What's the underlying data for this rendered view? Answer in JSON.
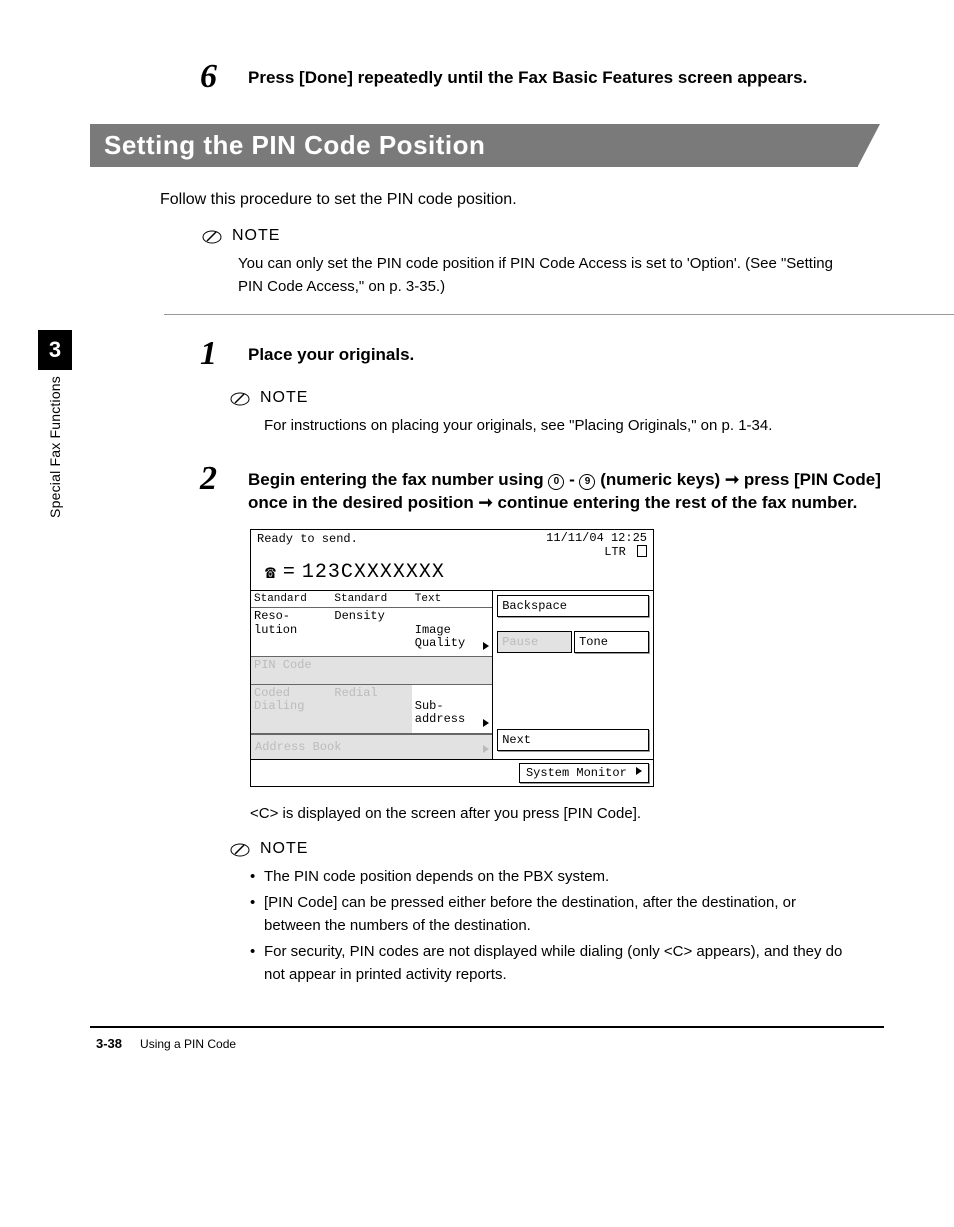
{
  "sidetab": {
    "number": "3",
    "label": "Special Fax Functions"
  },
  "step6": {
    "num": "6",
    "text": "Press [Done] repeatedly until the Fax Basic Features screen appears."
  },
  "section_title": "Setting the PIN Code Position",
  "intro": "Follow this procedure to set the PIN code position.",
  "note_label": "NOTE",
  "note1": "You can only set the PIN code position if PIN Code Access is set to 'Option'. (See \"Setting PIN Code Access,\" on p. 3-35.)",
  "step1": {
    "num": "1",
    "text": "Place your originals.",
    "note": "For instructions on placing your originals, see \"Placing Originals,\" on p. 1-34."
  },
  "step2": {
    "num": "2",
    "text_pre": "Begin entering the fax number using ",
    "key0": "0",
    "dash": " - ",
    "key9": "9",
    "text_mid": " (numeric keys) ",
    "arrow": "➞",
    "text_post1": " press [PIN Code] once in the desired position ",
    "text_post2": " continue entering the rest of the fax number.",
    "c_text": "<C> is displayed on the screen after you press [PIN Code].",
    "bullets": [
      "The PIN code position depends on the PBX system.",
      "[PIN Code] can be pressed either before the destination, after the destination, or between the numbers of the destination.",
      "For security, PIN codes are not displayed while dialing (only <C> appears), and they do not appear in printed activity reports."
    ]
  },
  "lcd": {
    "ready": "Ready to send.",
    "datetime": "11/11/04 12:25",
    "ltr": "LTR",
    "dial_prefix": "=",
    "dial_value": "123CXXXXXXX",
    "row1": {
      "c1": "Standard",
      "c2": "Standard",
      "c3": "Text"
    },
    "row2": {
      "c1": "Reso-\nlution",
      "c2": "Density",
      "c3": "Image\nQuality"
    },
    "pin_code": "PIN Code",
    "row3": {
      "c1": "Coded\nDialing",
      "c2": "Redial",
      "c3": "Sub-\naddress"
    },
    "address_book": "Address Book",
    "backspace": "Backspace",
    "pause": "Pause",
    "tone": "Tone",
    "next": "Next",
    "system_monitor": "System Monitor"
  },
  "footer": {
    "page": "3-38",
    "title": "Using a PIN Code"
  }
}
